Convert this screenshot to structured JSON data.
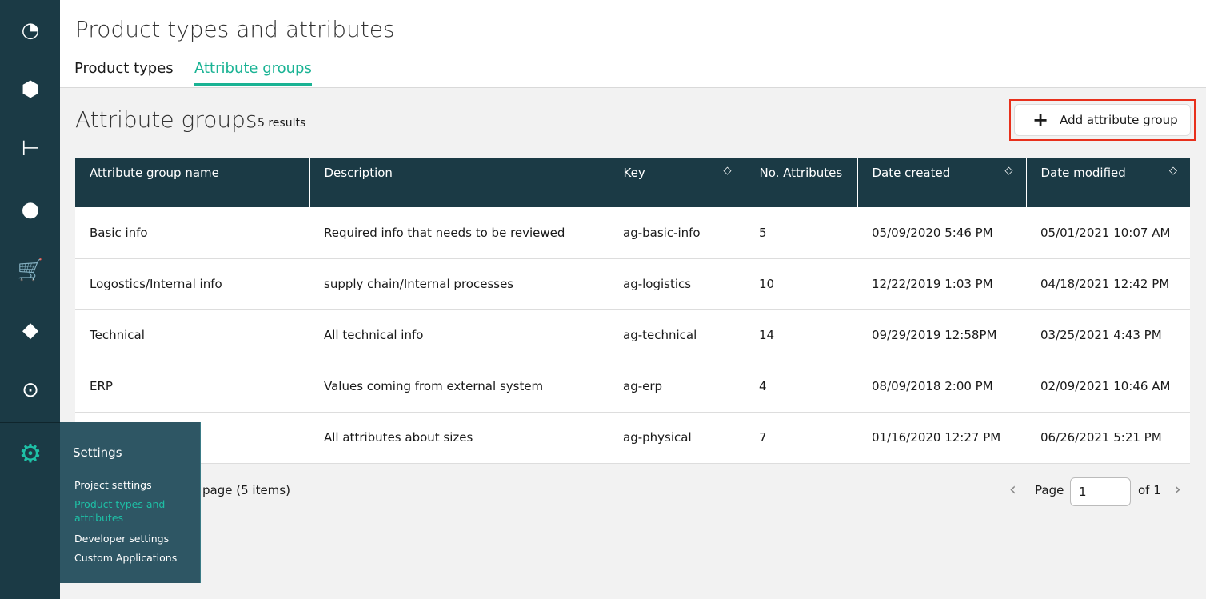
{
  "nav": {
    "icons": [
      "dashboard-icon",
      "products-icon",
      "categories-icon",
      "customers-icon",
      "cart-icon",
      "discounts-icon",
      "audit-icon"
    ],
    "settings_icon": "gear-icon"
  },
  "flyout": {
    "title": "Settings",
    "items": [
      "Project settings",
      "Product types and attributes",
      "Developer settings",
      "Custom Applications"
    ],
    "active_index": 1,
    "accent": "#1ec0a6"
  },
  "header": {
    "title": "Product types and attributes",
    "tabs": [
      "Product types",
      "Attribute groups"
    ],
    "active_tab": 1
  },
  "section": {
    "title": "Attribute groups",
    "count": "5 results",
    "add_button": "Add attribute group"
  },
  "table": {
    "columns": [
      "Attribute group name",
      "Description",
      "Key",
      "No. Attributes",
      "Date created",
      "Date modified"
    ],
    "rows": [
      [
        "Basic info",
        "Required info that needs to be reviewed",
        "ag-basic-info",
        "5",
        "05/09/2020 5:46 PM",
        "05/01/2021 10:07 AM"
      ],
      [
        "Logostics/Internal info",
        "supply chain/Internal processes",
        "ag-logistics",
        "10",
        "12/22/2019 1:03 PM",
        "04/18/2021 12:42 PM"
      ],
      [
        "Technical",
        "All technical info",
        "ag-technical",
        "14",
        "09/29/2019 12:58PM",
        "03/25/2021 4:43 PM"
      ],
      [
        "ERP",
        "Values coming from external system",
        "ag-erp",
        "4",
        "08/09/2018 2:00 PM",
        "02/09/2021 10:46 AM"
      ],
      [
        "",
        "All attributes about sizes",
        "ag-physical",
        "7",
        "01/16/2020 12:27 PM",
        "06/26/2021 5:21 PM"
      ]
    ]
  },
  "pagination": {
    "per_page_partial": "page (5 items)",
    "page_label": "Page",
    "page": "1",
    "of": "of 1"
  }
}
